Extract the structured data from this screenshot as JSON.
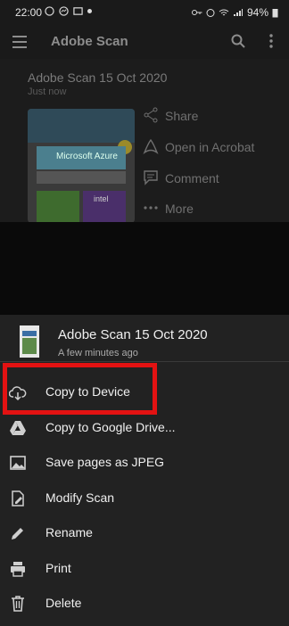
{
  "status": {
    "time": "22:00",
    "battery": "94%"
  },
  "appbar": {
    "title": "Adobe Scan"
  },
  "scan": {
    "title": "Adobe Scan 15 Oct 2020",
    "subtitle": "Just now",
    "thumb_text": "Microsoft Azure"
  },
  "side_actions": [
    {
      "label": "Share",
      "icon": "share-icon"
    },
    {
      "label": "Open in Acrobat",
      "icon": "acrobat-icon"
    },
    {
      "label": "Comment",
      "icon": "comment-icon"
    },
    {
      "label": "More",
      "icon": "more-icon"
    }
  ],
  "sheet": {
    "file_name": "Adobe Scan 15 Oct 2020",
    "file_meta": "A few minutes ago",
    "items": [
      {
        "label": "Copy to Device",
        "icon": "cloud-download-icon"
      },
      {
        "label": "Copy to Google Drive...",
        "icon": "google-drive-icon"
      },
      {
        "label": "Save pages as JPEG",
        "icon": "image-icon"
      },
      {
        "label": "Modify Scan",
        "icon": "modify-scan-icon"
      },
      {
        "label": "Rename",
        "icon": "pencil-icon"
      },
      {
        "label": "Print",
        "icon": "printer-icon"
      },
      {
        "label": "Delete",
        "icon": "trash-icon"
      }
    ]
  },
  "colors": {
    "highlight": "#e31212",
    "sheet_bg": "#222222"
  }
}
